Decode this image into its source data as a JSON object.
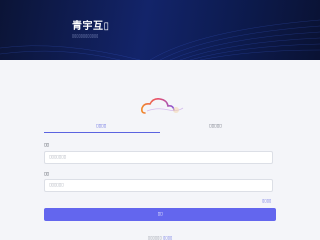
{
  "brand": {
    "title": "青宇互▯",
    "subtitle": "▯▯▯▯▯▯▯▯▯▯▯▯"
  },
  "tabs": {
    "account_label": "▯▯▯▯",
    "phone_label": "▯▯▯▯▯"
  },
  "form": {
    "username_label": "▯▯",
    "username_placeholder": "▯▯▯▯▯▯▯",
    "username_value": "",
    "password_label": "▯▯",
    "password_placeholder": "▯▯▯▯▯▯",
    "password_value": "",
    "forgot_label": "▯▯▯▯",
    "login_label": "▯▯"
  },
  "footer": {
    "prompt": "▯▯▯▯▯▯ ",
    "register_label": "▯▯▯▯"
  },
  "colors": {
    "accent": "#6366ee",
    "hero_dark": "#0b1436"
  }
}
